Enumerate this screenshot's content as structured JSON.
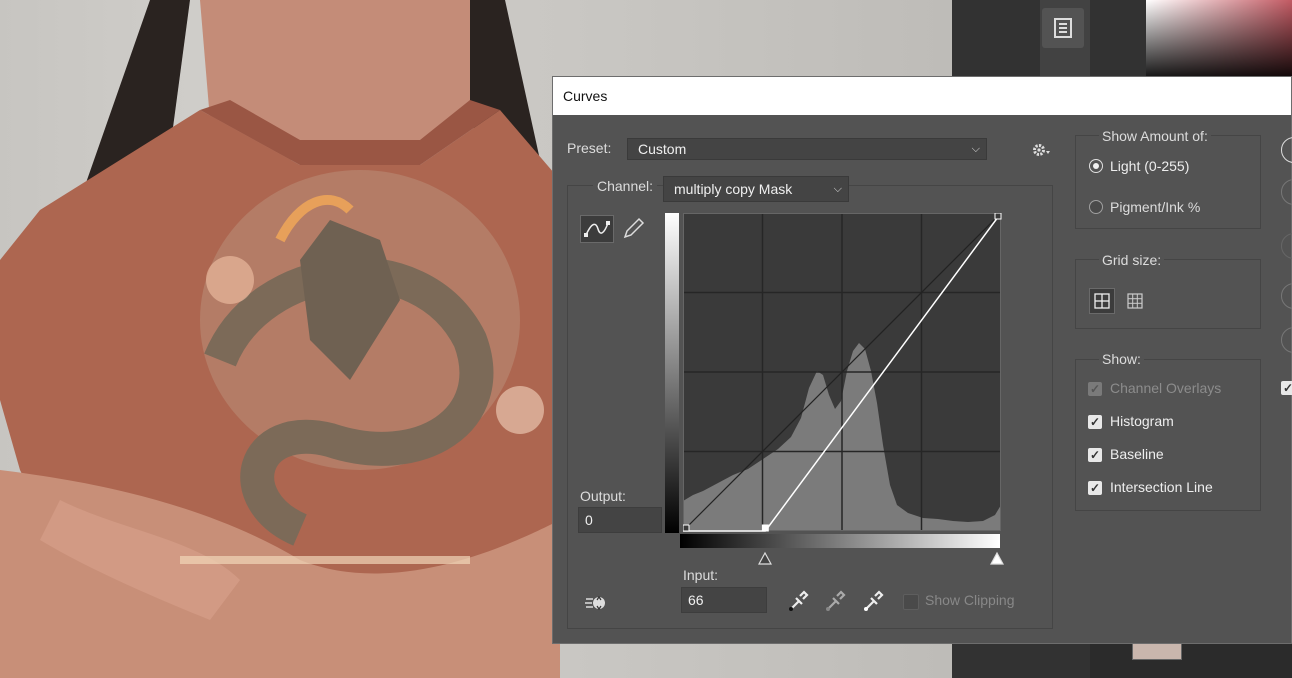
{
  "dialog": {
    "title": "Curves",
    "preset_label": "Preset:",
    "preset_value": "Custom",
    "channel_label": "Channel:",
    "channel_value": "multiply copy Mask",
    "output_label": "Output:",
    "output_value": "0",
    "input_label": "Input:",
    "input_value": "66",
    "show_clipping_label": "Show Clipping",
    "show_amount_title": "Show Amount of:",
    "light_label": "Light  (0-255)",
    "pigment_label": "Pigment/Ink %",
    "grid_size_title": "Grid size:",
    "show_title": "Show:",
    "channel_overlays_label": "Channel Overlays",
    "histogram_label": "Histogram",
    "baseline_label": "Baseline",
    "intersection_line_label": "Intersection Line"
  },
  "curve": {
    "points": [
      [
        0,
        0
      ],
      [
        66,
        0
      ],
      [
        255,
        255
      ]
    ]
  },
  "colors": {
    "dialog_bg": "#535353",
    "graph_bg": "#3a3a3a",
    "histogram": "#7b7b7b"
  }
}
